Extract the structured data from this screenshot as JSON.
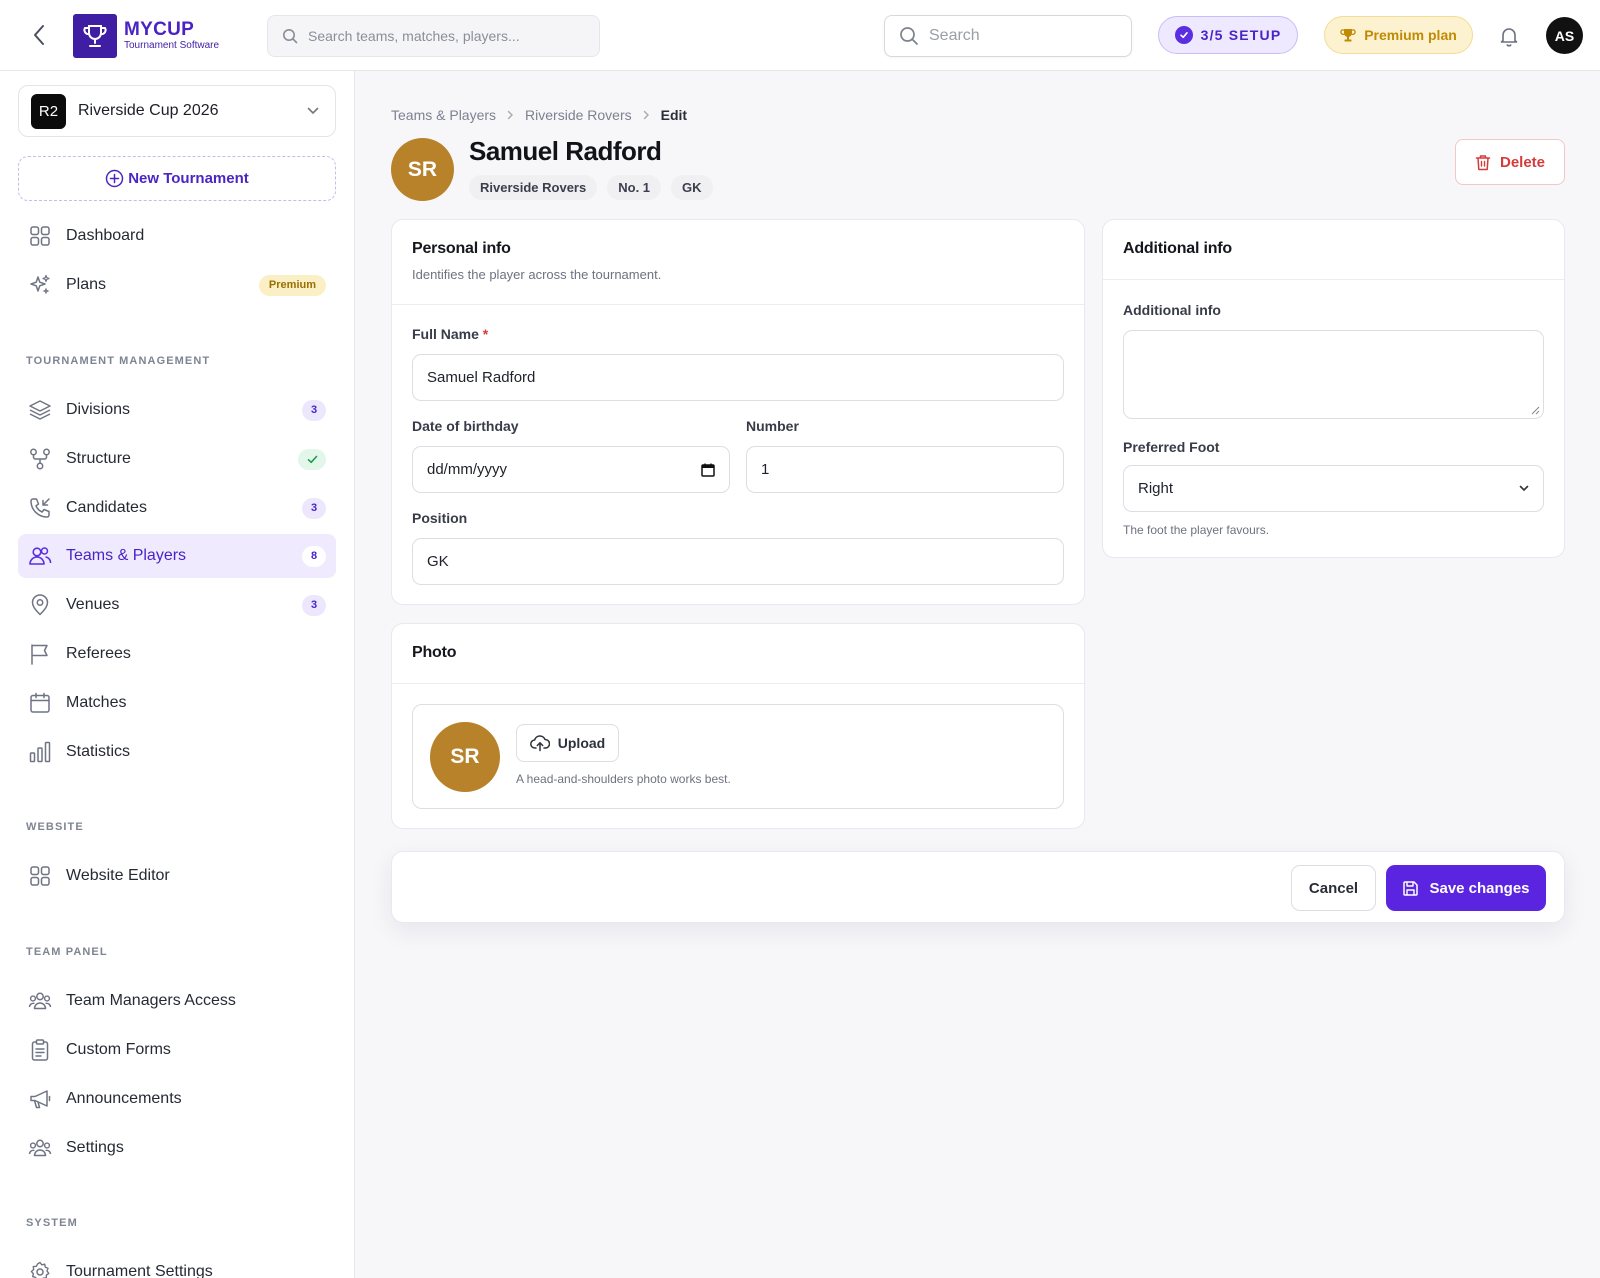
{
  "header": {
    "logo_title": "MYCUP",
    "logo_subtitle": "Tournament Software",
    "search_placeholder": "Search teams, matches, players...",
    "search2_placeholder": "Search",
    "setup_label": "3/5 SETUP",
    "premium_label": "Premium plan",
    "user_initials": "AS"
  },
  "sidebar": {
    "tournament_badge": "R2",
    "tournament_name": "Riverside Cup 2026",
    "new_tournament": "New Tournament",
    "top_items": [
      {
        "label": "Dashboard",
        "icon": "grid-icon"
      },
      {
        "label": "Plans",
        "icon": "sparkles-icon",
        "badge": "Premium"
      }
    ],
    "sections": [
      {
        "title": "TOURNAMENT MANAGEMENT",
        "items": [
          {
            "label": "Divisions",
            "icon": "layers-icon",
            "count": "3"
          },
          {
            "label": "Structure",
            "icon": "structure-icon",
            "status": "check"
          },
          {
            "label": "Candidates",
            "icon": "phone-incoming-icon",
            "count": "3"
          },
          {
            "label": "Teams & Players",
            "icon": "users-icon",
            "count": "8",
            "active": true
          },
          {
            "label": "Venues",
            "icon": "map-pin-icon",
            "count": "3"
          },
          {
            "label": "Referees",
            "icon": "flag-icon"
          },
          {
            "label": "Matches",
            "icon": "calendar-icon"
          },
          {
            "label": "Statistics",
            "icon": "bar-chart-icon"
          }
        ]
      },
      {
        "title": "WEBSITE",
        "items": [
          {
            "label": "Website Editor",
            "icon": "grid-icon"
          }
        ]
      },
      {
        "title": "TEAM PANEL",
        "items": [
          {
            "label": "Team Managers Access",
            "icon": "users-group-icon"
          },
          {
            "label": "Custom Forms",
            "icon": "clipboard-icon"
          },
          {
            "label": "Announcements",
            "icon": "megaphone-icon"
          },
          {
            "label": "Settings",
            "icon": "users-group-icon"
          }
        ]
      },
      {
        "title": "SYSTEM",
        "items": [
          {
            "label": "Tournament Settings",
            "icon": "gear-icon"
          }
        ]
      }
    ]
  },
  "breadcrumb": [
    "Teams & Players",
    "Riverside Rovers",
    "Edit"
  ],
  "player": {
    "initials": "SR",
    "name": "Samuel Radford",
    "team": "Riverside Rovers",
    "number_chip": "No. 1",
    "position_chip": "GK"
  },
  "delete_label": "Delete",
  "personal_info": {
    "title": "Personal info",
    "description": "Identifies the player across the tournament.",
    "full_name_label": "Full Name",
    "required_mark": "*",
    "full_name_value": "Samuel Radford",
    "dob_label": "Date of birthday",
    "dob_placeholder": "dd/mm/yyyy",
    "number_label": "Number",
    "number_value": "1",
    "position_label": "Position",
    "position_value": "GK"
  },
  "additional_info": {
    "title": "Additional info",
    "field_label": "Additional info",
    "field_value": "",
    "foot_label": "Preferred Foot",
    "foot_value": "Right",
    "foot_hint": "The foot the player favours."
  },
  "photo": {
    "title": "Photo",
    "initials": "SR",
    "upload_label": "Upload",
    "hint": "A head-and-shoulders photo works best."
  },
  "actions": {
    "cancel": "Cancel",
    "save": "Save changes"
  },
  "colors": {
    "brand": "#5b24e0",
    "avatar": "#b8822a",
    "danger": "#d63b3b",
    "premium": "#c08a05"
  }
}
